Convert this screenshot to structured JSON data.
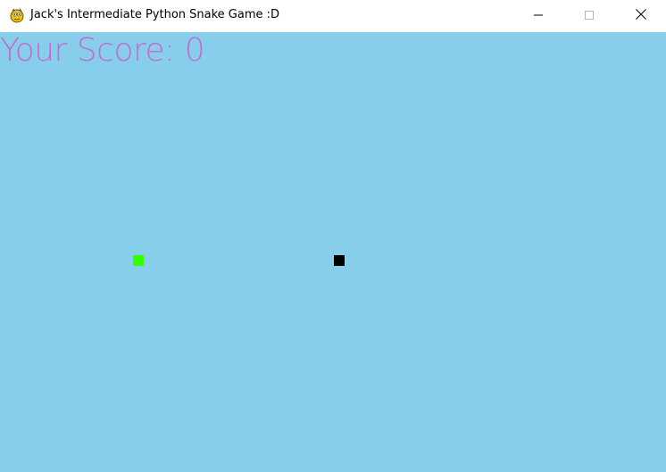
{
  "window": {
    "title": "Jack's Intermediate Python Snake Game :D",
    "icon": "pygame-snake-icon",
    "controls": {
      "minimize_icon": "minimize-icon",
      "maximize_icon": "maximize-icon",
      "close_icon": "close-icon"
    }
  },
  "game": {
    "background_color": "#87ceeb",
    "score_label": "Your Score: ",
    "score_value": "0",
    "score_color": "#c46ad0",
    "food_color": "#33ff00",
    "snake_color": "#000000"
  }
}
